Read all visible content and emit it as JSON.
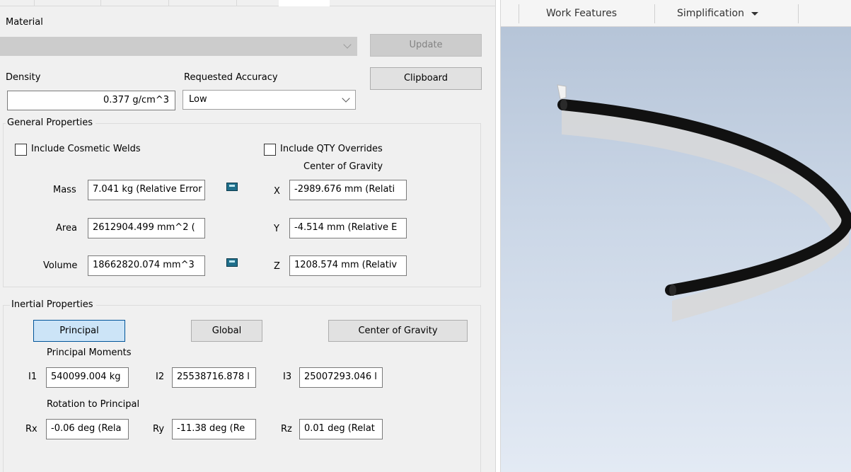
{
  "dialog": {
    "material_label": "Material",
    "material_value": "",
    "update_button": "Update",
    "density_label": "Density",
    "density_value": "0.377 g/cm^3",
    "accuracy_label": "Requested Accuracy",
    "accuracy_value": "Low",
    "clipboard_button": "Clipboard",
    "general": {
      "legend": "General Properties",
      "include_welds": "Include Cosmetic Welds",
      "include_qty": "Include QTY Overrides",
      "cog_title": "Center of Gravity",
      "mass_label": "Mass",
      "mass_value": "7.041 kg (Relative Error",
      "area_label": "Area",
      "area_value": "2612904.499 mm^2 (",
      "volume_label": "Volume",
      "volume_value": "18662820.074 mm^3",
      "x_label": "X",
      "x_value": "-2989.676 mm (Relati",
      "y_label": "Y",
      "y_value": "-4.514 mm (Relative E",
      "z_label": "Z",
      "z_value": "1208.574 mm (Relativ"
    },
    "inertial": {
      "legend": "Inertial Properties",
      "principal_button": "Principal",
      "global_button": "Global",
      "cog_button": "Center of Gravity",
      "moments_title": "Principal Moments",
      "i1_label": "I1",
      "i1_value": "540099.004 kg",
      "i2_label": "I2",
      "i2_value": "25538716.878 l",
      "i3_label": "I3",
      "i3_value": "25007293.046 l",
      "rotation_title": "Rotation to Principal",
      "rx_label": "Rx",
      "rx_value": "-0.06 deg (Rela",
      "ry_label": "Ry",
      "ry_value": "-11.38 deg (Re",
      "rz_label": "Rz",
      "rz_value": "0.01 deg (Relat"
    }
  },
  "ribbon": {
    "work_features": "Work Features",
    "simplification": "Simplification"
  },
  "viewport": {
    "model_color": "#111111",
    "shadow_color": "#d8d8d8"
  }
}
